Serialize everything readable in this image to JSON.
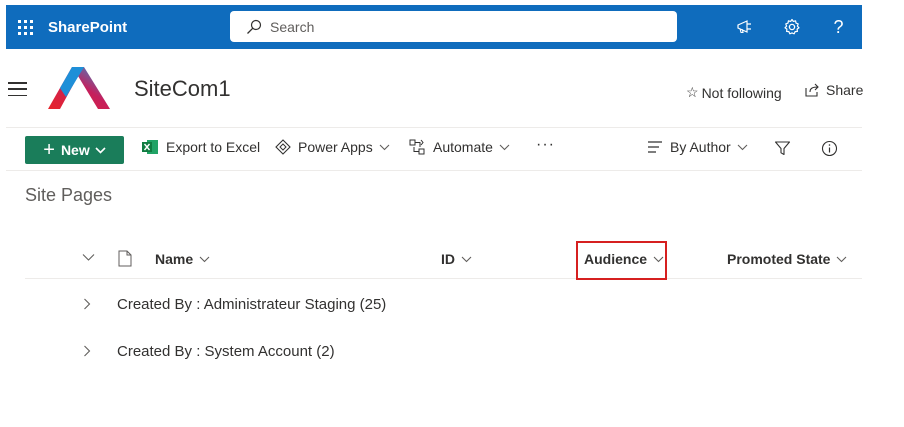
{
  "suitebar": {
    "app_name": "SharePoint",
    "search_placeholder": "Search",
    "icons": [
      "megaphone-icon",
      "gear-icon",
      "help-icon"
    ],
    "help_glyph": "?",
    "color": "#0f6cbd"
  },
  "site": {
    "title": "SiteCom1",
    "follow_label": "Not following",
    "share_label": "Share"
  },
  "commandbar": {
    "new_label": "New",
    "export_label": "Export to Excel",
    "powerapps_label": "Power Apps",
    "automate_label": "Automate",
    "more_label": "···",
    "view_label": "By Author",
    "new_color": "#1a7d5a"
  },
  "list": {
    "title": "Site Pages",
    "columns": [
      "Name",
      "ID",
      "Audience",
      "Promoted State"
    ],
    "highlighted_column": "Audience",
    "highlight_color": "#d62020",
    "groups": [
      "Created By : Administrateur Staging (25)",
      "Created By : System Account (2)"
    ]
  }
}
